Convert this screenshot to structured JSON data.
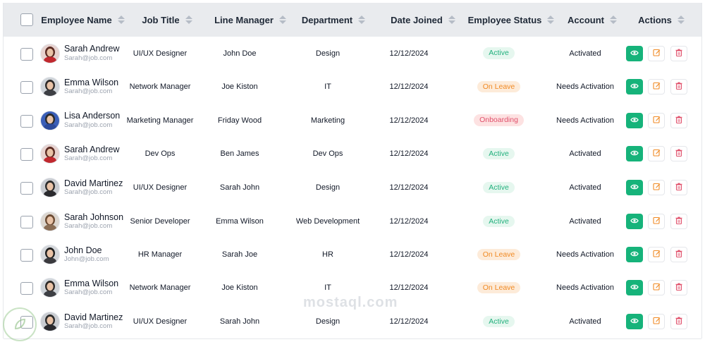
{
  "columns": {
    "name": "Employee Name",
    "job": "Job Title",
    "manager": "Line Manager",
    "department": "Department",
    "date": "Date Joined",
    "status": "Employee Status",
    "account": "Account",
    "actions": "Actions"
  },
  "status_colors": {
    "Active": {
      "bg": "#e6f7ef",
      "fg": "#22b07d"
    },
    "On Leave": {
      "bg": "#fdebd9",
      "fg": "#f08a24"
    },
    "Onboarding": {
      "bg": "#fde2e2",
      "fg": "#e0506b"
    }
  },
  "rows": [
    {
      "name": "Sarah Andrew",
      "email": "Sarah@job.com",
      "job": "UI/UX Designer",
      "manager": "John Doe",
      "department": "Design",
      "date": "12/12/2024",
      "status": "Active",
      "account": "Activated",
      "avatar_bg": "#e7d2cf",
      "avatar_hair": "#5a2a22",
      "avatar_shirt": "#c0282e"
    },
    {
      "name": "Emma Wilson",
      "email": "Sarah@job.com",
      "job": "Network Manager",
      "manager": "Joe Kiston",
      "department": "IT",
      "date": "12/12/2024",
      "status": "On Leave",
      "account": "Needs Activation",
      "avatar_bg": "#cfd4d9",
      "avatar_hair": "#2e2a28",
      "avatar_shirt": "#3d3f44"
    },
    {
      "name": "Lisa Anderson",
      "email": "Sarah@job.com",
      "job": "Marketing Manager",
      "manager": "Friday Wood",
      "department": "Marketing",
      "date": "12/12/2024",
      "status": "Onboarding",
      "account": "Needs Activation",
      "avatar_bg": "#3b5fb8",
      "avatar_hair": "#2a2a2a",
      "avatar_shirt": "#2c4a9a"
    },
    {
      "name": "Sarah Andrew",
      "email": "Sarah@job.com",
      "job": "Dev Ops",
      "manager": "Ben James",
      "department": "Dev Ops",
      "date": "12/12/2024",
      "status": "Active",
      "account": "Activated",
      "avatar_bg": "#e7d2cf",
      "avatar_hair": "#5a2a22",
      "avatar_shirt": "#c0282e"
    },
    {
      "name": "David Martinez",
      "email": "Sarah@job.com",
      "job": "UI/UX Designer",
      "manager": "Sarah John",
      "department": "Design",
      "date": "12/12/2024",
      "status": "Active",
      "account": "Activated",
      "avatar_bg": "#c9ccd1",
      "avatar_hair": "#2b2b2b",
      "avatar_shirt": "#2a2a2e"
    },
    {
      "name": "Sarah Johnson",
      "email": "Sarah@job.com",
      "job": "Senior Developer",
      "manager": "Emma Wilson",
      "department": "Web Development",
      "date": "12/12/2024",
      "status": "Active",
      "account": "Activated",
      "avatar_bg": "#dcd6cf",
      "avatar_hair": "#6b4a33",
      "avatar_shirt": "#8a6d55"
    },
    {
      "name": "John Doe",
      "email": "John@job.com",
      "job": "HR Manager",
      "manager": "Sarah Joe",
      "department": "HR",
      "date": "12/12/2024",
      "status": "On Leave",
      "account": "Needs Activation",
      "avatar_bg": "#d3d6da",
      "avatar_hair": "#1e1e1e",
      "avatar_shirt": "#3a3a3e"
    },
    {
      "name": "Emma Wilson",
      "email": "Sarah@job.com",
      "job": "Network Manager",
      "manager": "Joe Kiston",
      "department": "IT",
      "date": "12/12/2024",
      "status": "On Leave",
      "account": "Needs Activation",
      "avatar_bg": "#cfd4d9",
      "avatar_hair": "#2e2a28",
      "avatar_shirt": "#3d3f44"
    },
    {
      "name": "David Martinez",
      "email": "Sarah@job.com",
      "job": "UI/UX Designer",
      "manager": "Sarah John",
      "department": "Design",
      "date": "12/12/2024",
      "status": "Active",
      "account": "Activated",
      "avatar_bg": "#c9ccd1",
      "avatar_hair": "#2b2b2b",
      "avatar_shirt": "#2a2a2e"
    }
  ],
  "actions": {
    "view_icon": "eye-icon",
    "edit_icon": "edit-icon",
    "delete_icon": "trash-icon"
  },
  "watermark": {
    "text": "mostaql.com"
  },
  "colors": {
    "view_btn": "#16b37a",
    "edit_icon": "#f08a24",
    "delete_icon": "#e0506b"
  }
}
